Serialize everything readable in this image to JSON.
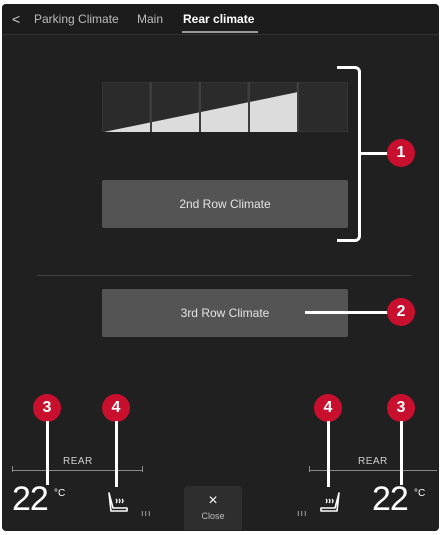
{
  "header": {
    "back_glyph": "<",
    "tabs": [
      {
        "label": "Parking Climate"
      },
      {
        "label": "Main"
      },
      {
        "label": "Rear climate"
      }
    ]
  },
  "fan": {
    "segments": 5,
    "level_fraction": 0.8
  },
  "buttons": {
    "second_row": "2nd Row Climate",
    "third_row": "3rd Row Climate"
  },
  "callouts": [
    "1",
    "2",
    "3",
    "4",
    "4",
    "3"
  ],
  "left_zone": {
    "label": "REAR",
    "temperature": "22",
    "unit": "°C",
    "heat_bars": "ııı"
  },
  "right_zone": {
    "label": "REAR",
    "temperature": "22",
    "unit": "°C",
    "heat_bars": "ııı"
  },
  "close": {
    "icon": "×",
    "label": "Close"
  },
  "colors": {
    "callout": "#c8102e",
    "background": "#202020",
    "button": "#545454"
  }
}
